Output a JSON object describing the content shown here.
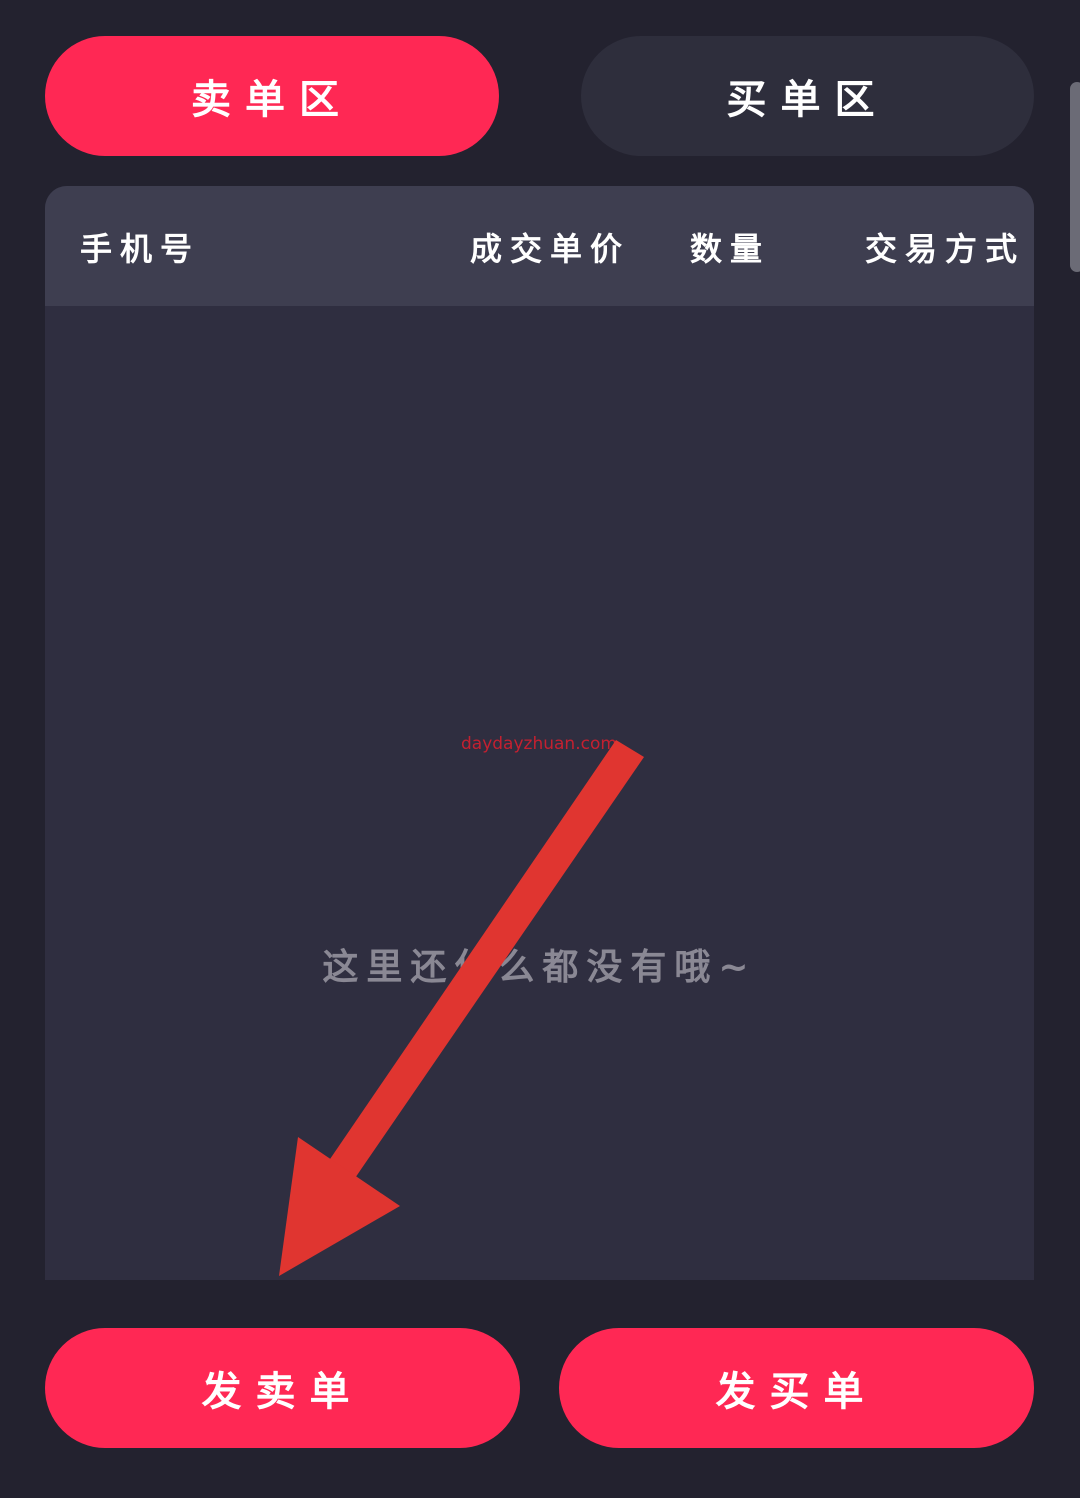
{
  "tabs": {
    "sell_zone": "卖单区",
    "buy_zone": "买单区"
  },
  "table": {
    "columns": [
      "手机号",
      "成交单价",
      "数量",
      "交易方式"
    ],
    "empty_message": "这里还什么都没有哦~"
  },
  "watermark": "daydayzhuan.com",
  "actions": {
    "post_sell": "发卖单",
    "post_buy": "发买单"
  },
  "colors": {
    "background": "#23222f",
    "accent": "#ff2854",
    "inactive_tab": "#2e2e3c",
    "panel": "#2f2e40",
    "panel_header": "#3e3e50",
    "annotation_arrow": "#e03530"
  }
}
